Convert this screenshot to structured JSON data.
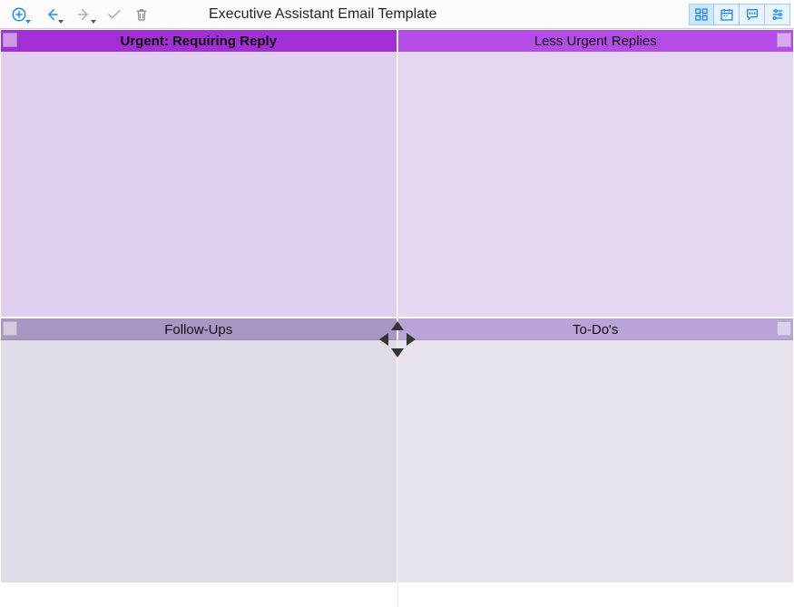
{
  "header": {
    "title": "Executive Assistant Email Template"
  },
  "toolbar": {
    "add_label": "Add",
    "back_label": "Back",
    "forward_label": "Forward",
    "mark_label": "Mark complete",
    "delete_label": "Delete",
    "view_grid_label": "Grid view",
    "view_cal_label": "Calendar view",
    "view_chat_label": "Comment view",
    "view_settings_label": "Settings"
  },
  "panes": {
    "top_left": {
      "title": "Urgent: Requiring Reply"
    },
    "top_right": {
      "title": "Less Urgent Replies"
    },
    "bottom_left": {
      "title": "Follow-Ups"
    },
    "bottom_right": {
      "title": "To-Do's"
    }
  },
  "colors": {
    "accent_purple_dark": "#a22ed6",
    "accent_purple_mid": "#b44de8",
    "accent_purple_muted": "#a996c2",
    "accent_blue": "#1a8cff"
  }
}
